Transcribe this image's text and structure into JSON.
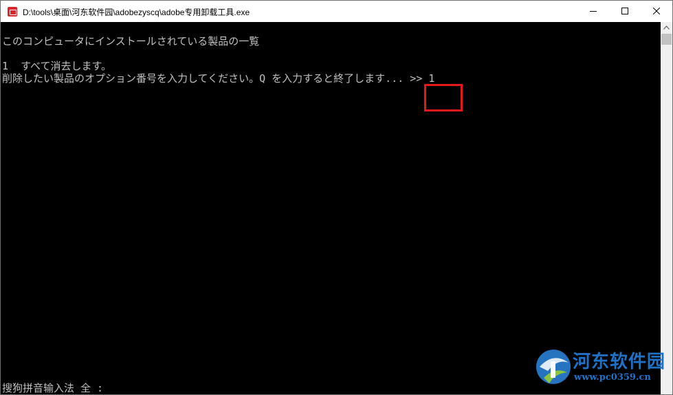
{
  "window": {
    "title": "D:\\tools\\桌面\\河东软件园\\adobezyscq\\adobe专用卸载工具.exe"
  },
  "console": {
    "lines": [
      "このコンピュータにインストールされている製品の一覧",
      "1  すべて消去します。",
      "削除したい製品のオプション番号を入力してください。Q を入力すると終了します... >> 1"
    ],
    "ime_status": "搜狗拼音输入法 全 :"
  },
  "watermark": {
    "name": "河东软件园",
    "url": "www.pc0359.cn"
  },
  "colors": {
    "console_bg": "#000000",
    "console_text": "#c0c0c0",
    "highlight": "#e5191c",
    "watermark": "#1e73c8"
  },
  "icons": {
    "app": "adobe-uninstaller-icon",
    "minimize": "minimize-icon",
    "maximize": "maximize-icon",
    "close": "close-icon",
    "scroll_up": "chevron-up-icon"
  }
}
